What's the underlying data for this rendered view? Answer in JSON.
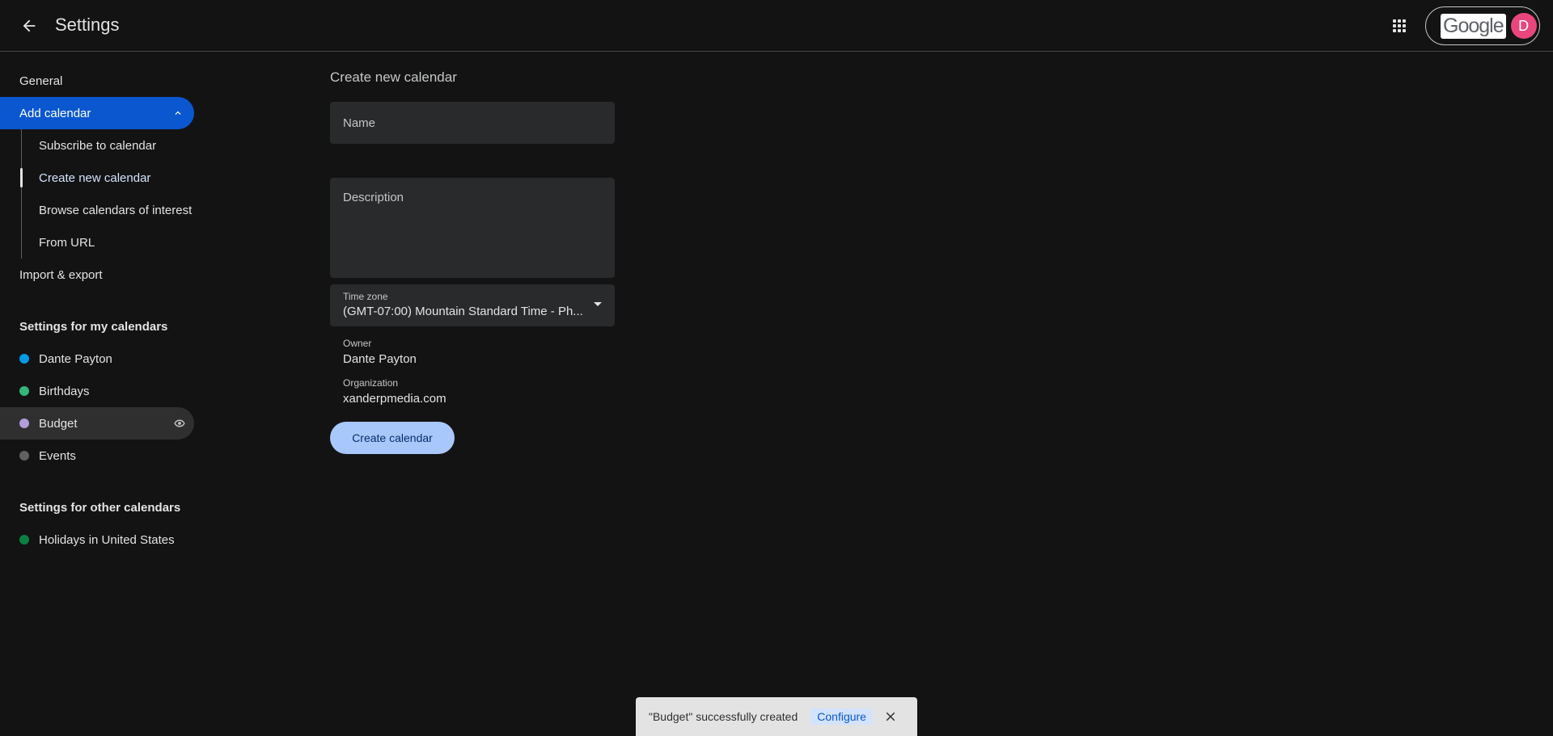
{
  "header": {
    "title": "Settings",
    "logo_text": "Google",
    "avatar_initial": "D"
  },
  "sidebar": {
    "general": "General",
    "add_calendar": "Add calendar",
    "sub_items": [
      "Subscribe to calendar",
      "Create new calendar",
      "Browse calendars of interest",
      "From URL"
    ],
    "import_export": "Import & export",
    "my_calendars_heading": "Settings for my calendars",
    "my_calendars": [
      {
        "name": "Dante Payton",
        "color": "#039be5"
      },
      {
        "name": "Birthdays",
        "color": "#33b679"
      },
      {
        "name": "Budget",
        "color": "#b39ddb"
      },
      {
        "name": "Events",
        "color": "#616161"
      }
    ],
    "other_calendars_heading": "Settings for other calendars",
    "other_calendars": [
      {
        "name": "Holidays in United States",
        "color": "#0b8043"
      }
    ]
  },
  "form": {
    "title": "Create new calendar",
    "name_placeholder": "Name",
    "description_placeholder": "Description",
    "timezone_label": "Time zone",
    "timezone_value": "(GMT-07:00) Mountain Standard Time - Ph...",
    "owner_label": "Owner",
    "owner_value": "Dante Payton",
    "organization_label": "Organization",
    "organization_value": "xanderpmedia.com",
    "submit_label": "Create calendar"
  },
  "snackbar": {
    "message": "\"Budget\" successfully created",
    "action_label": "Configure"
  },
  "colors": {
    "background": "#131313",
    "active_nav": "#0b57d0",
    "primary_button": "#a8c7fa",
    "avatar": "#e8467c"
  }
}
